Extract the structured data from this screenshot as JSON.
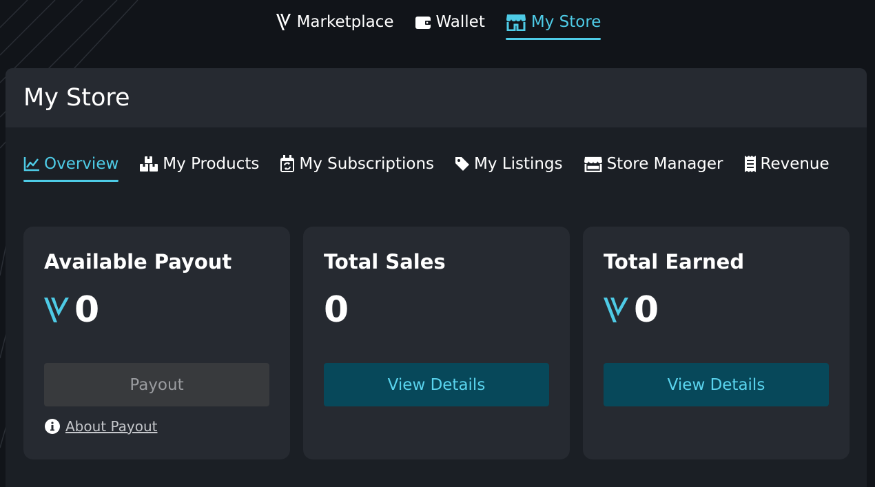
{
  "topnav": {
    "items": [
      {
        "label": "Marketplace",
        "icon": "v-logo-icon",
        "active": false
      },
      {
        "label": "Wallet",
        "icon": "wallet-icon",
        "active": false
      },
      {
        "label": "My Store",
        "icon": "store-icon",
        "active": true
      }
    ]
  },
  "page": {
    "title": "My Store"
  },
  "tabs": [
    {
      "label": "Overview",
      "icon": "chart-line-icon",
      "active": true
    },
    {
      "label": "My Products",
      "icon": "boxes-icon",
      "active": false
    },
    {
      "label": "My Subscriptions",
      "icon": "calendar-refresh-icon",
      "active": false
    },
    {
      "label": "My Listings",
      "icon": "tag-icon",
      "active": false
    },
    {
      "label": "Store Manager",
      "icon": "store-icon",
      "active": false
    },
    {
      "label": "Revenue",
      "icon": "receipt-icon",
      "active": false
    }
  ],
  "cards": {
    "payout": {
      "title": "Available Payout",
      "value": "0",
      "currency_icon": "v-currency-icon",
      "button_label": "Payout",
      "button_disabled": true,
      "about_label": "About Payout"
    },
    "sales": {
      "title": "Total Sales",
      "value": "0",
      "button_label": "View Details"
    },
    "earned": {
      "title": "Total Earned",
      "value": "0",
      "currency_icon": "v-currency-icon",
      "button_label": "View Details"
    }
  },
  "colors": {
    "accent": "#4ecbe6",
    "background": "#111419",
    "panel": "#1b1f25",
    "card": "#262a31",
    "primary_button": "#07485a",
    "disabled_button": "#383a3d"
  }
}
